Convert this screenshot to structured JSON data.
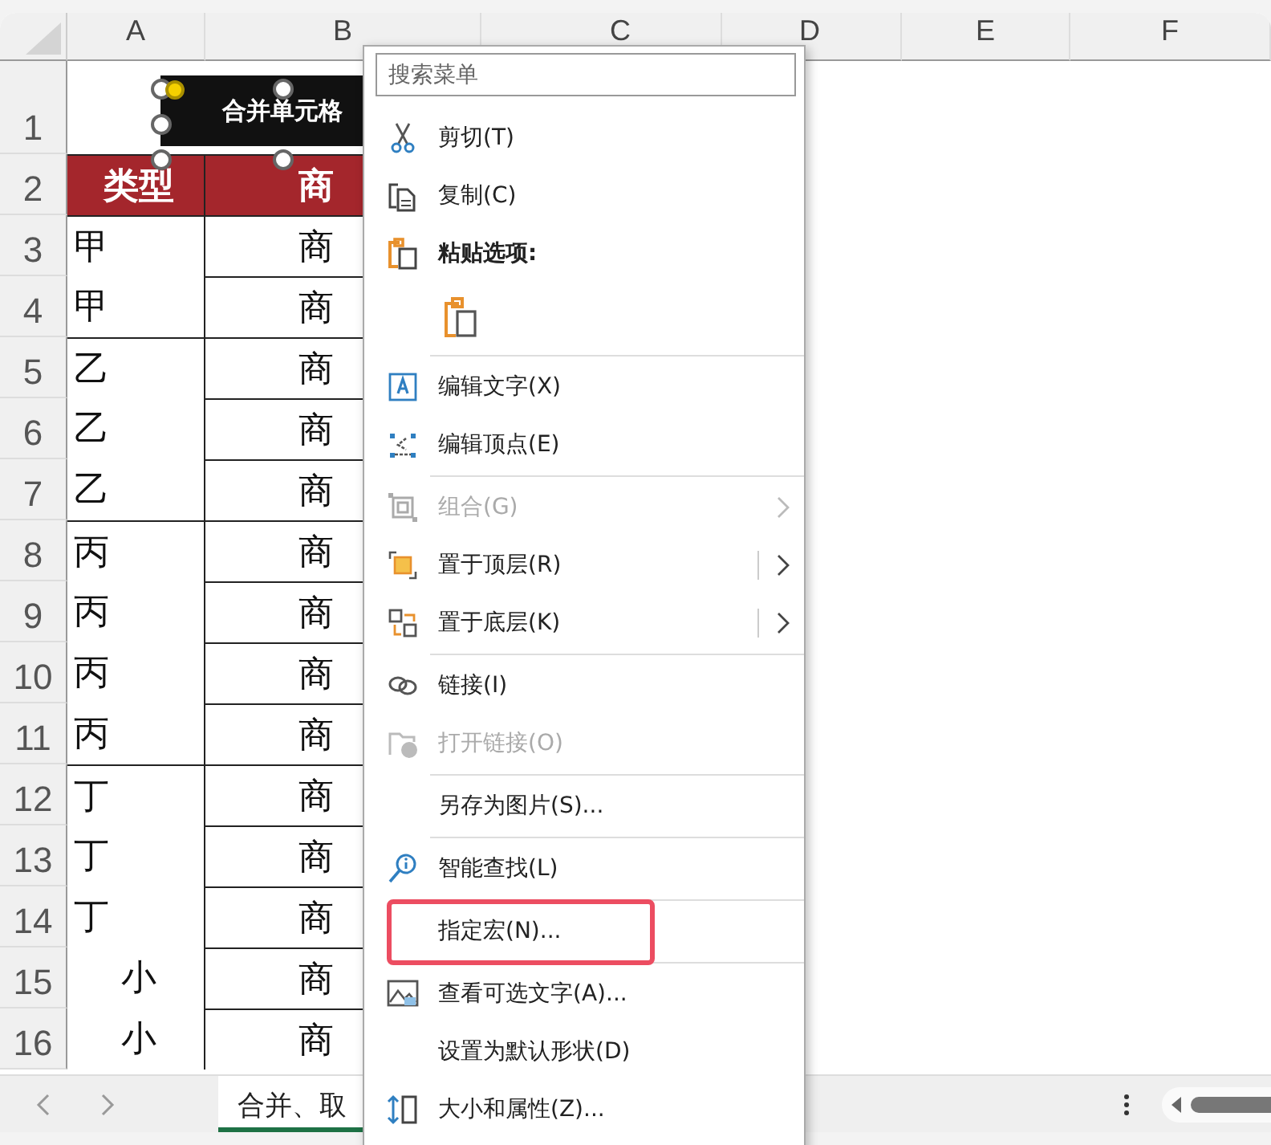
{
  "sheet": {
    "columns": [
      "A",
      "B",
      "C",
      "D",
      "E",
      "F"
    ],
    "shape": {
      "text": "合并单元格"
    },
    "rows": [
      {
        "number": "1",
        "a": "",
        "b": "",
        "header": false,
        "group_start": false
      },
      {
        "number": "2",
        "a": "类型",
        "b": "商",
        "header": true,
        "group_start": true,
        "centered": true
      },
      {
        "number": "3",
        "a": "甲",
        "b": "商",
        "header": false,
        "group_start": true,
        "centered": false
      },
      {
        "number": "4",
        "a": "甲",
        "b": "商",
        "header": false,
        "group_start": false,
        "centered": false
      },
      {
        "number": "5",
        "a": "乙",
        "b": "商",
        "header": false,
        "group_start": true,
        "centered": false
      },
      {
        "number": "6",
        "a": "乙",
        "b": "商",
        "header": false,
        "group_start": false,
        "centered": false
      },
      {
        "number": "7",
        "a": "乙",
        "b": "商",
        "header": false,
        "group_start": false,
        "centered": false
      },
      {
        "number": "8",
        "a": "丙",
        "b": "商",
        "header": false,
        "group_start": true,
        "centered": false
      },
      {
        "number": "9",
        "a": "丙",
        "b": "商",
        "header": false,
        "group_start": false,
        "centered": false
      },
      {
        "number": "10",
        "a": "丙",
        "b": "商",
        "header": false,
        "group_start": false,
        "centered": false
      },
      {
        "number": "11",
        "a": "丙",
        "b": "商",
        "header": false,
        "group_start": false,
        "centered": false
      },
      {
        "number": "12",
        "a": "丁",
        "b": "商",
        "header": false,
        "group_start": true,
        "centered": false
      },
      {
        "number": "13",
        "a": "丁",
        "b": "商",
        "header": false,
        "group_start": false,
        "centered": false
      },
      {
        "number": "14",
        "a": "丁",
        "b": "商",
        "header": false,
        "group_start": false,
        "centered": false
      },
      {
        "number": "15",
        "a": "小",
        "b": "商",
        "header": false,
        "group_start": false,
        "centered": true
      },
      {
        "number": "16",
        "a": "小",
        "b": "商",
        "header": false,
        "group_start": false,
        "centered": true
      }
    ]
  },
  "sheet_tabs": [
    {
      "label": "合并、取",
      "selected": true
    }
  ],
  "menu": {
    "search": {
      "placeholder": "搜索菜单"
    },
    "items": [
      {
        "kind": "item",
        "label": "剪切(T)",
        "disabled": false,
        "submenu": false,
        "split": false,
        "highlighted": false
      },
      {
        "kind": "item",
        "label": "复制(C)",
        "disabled": false,
        "submenu": false,
        "split": false,
        "highlighted": false
      },
      {
        "kind": "heading",
        "label": "粘贴选项:"
      },
      {
        "kind": "paste"
      },
      {
        "kind": "separator"
      },
      {
        "kind": "item",
        "label": "编辑文字(X)",
        "disabled": false,
        "submenu": false,
        "split": false,
        "highlighted": false
      },
      {
        "kind": "item",
        "label": "编辑顶点(E)",
        "disabled": false,
        "submenu": false,
        "split": false,
        "highlighted": false
      },
      {
        "kind": "separator"
      },
      {
        "kind": "item",
        "label": "组合(G)",
        "disabled": true,
        "submenu": true,
        "split": false,
        "highlighted": false
      },
      {
        "kind": "item",
        "label": "置于顶层(R)",
        "disabled": false,
        "submenu": true,
        "split": true,
        "highlighted": false
      },
      {
        "kind": "item",
        "label": "置于底层(K)",
        "disabled": false,
        "submenu": true,
        "split": true,
        "highlighted": false
      },
      {
        "kind": "separator"
      },
      {
        "kind": "item",
        "label": "链接(I)",
        "disabled": false,
        "submenu": false,
        "split": false,
        "highlighted": false
      },
      {
        "kind": "item",
        "label": "打开链接(O)",
        "disabled": true,
        "submenu": false,
        "split": false,
        "highlighted": false
      },
      {
        "kind": "separator"
      },
      {
        "kind": "item",
        "label": "另存为图片(S)...",
        "disabled": false,
        "submenu": false,
        "split": false,
        "highlighted": false
      },
      {
        "kind": "separator"
      },
      {
        "kind": "item",
        "label": "智能查找(L)",
        "disabled": false,
        "submenu": false,
        "split": false,
        "highlighted": false
      },
      {
        "kind": "separator"
      },
      {
        "kind": "item",
        "label": "指定宏(N)...",
        "disabled": false,
        "submenu": false,
        "split": false,
        "highlighted": true
      },
      {
        "kind": "separator"
      },
      {
        "kind": "item",
        "label": "查看可选文字(A)...",
        "disabled": false,
        "submenu": false,
        "split": false,
        "highlighted": false
      },
      {
        "kind": "item",
        "label": "设置为默认形状(D)",
        "disabled": false,
        "submenu": false,
        "split": false,
        "highlighted": false
      },
      {
        "kind": "item",
        "label": "大小和属性(Z)...",
        "disabled": false,
        "submenu": false,
        "split": false,
        "highlighted": false
      }
    ]
  }
}
